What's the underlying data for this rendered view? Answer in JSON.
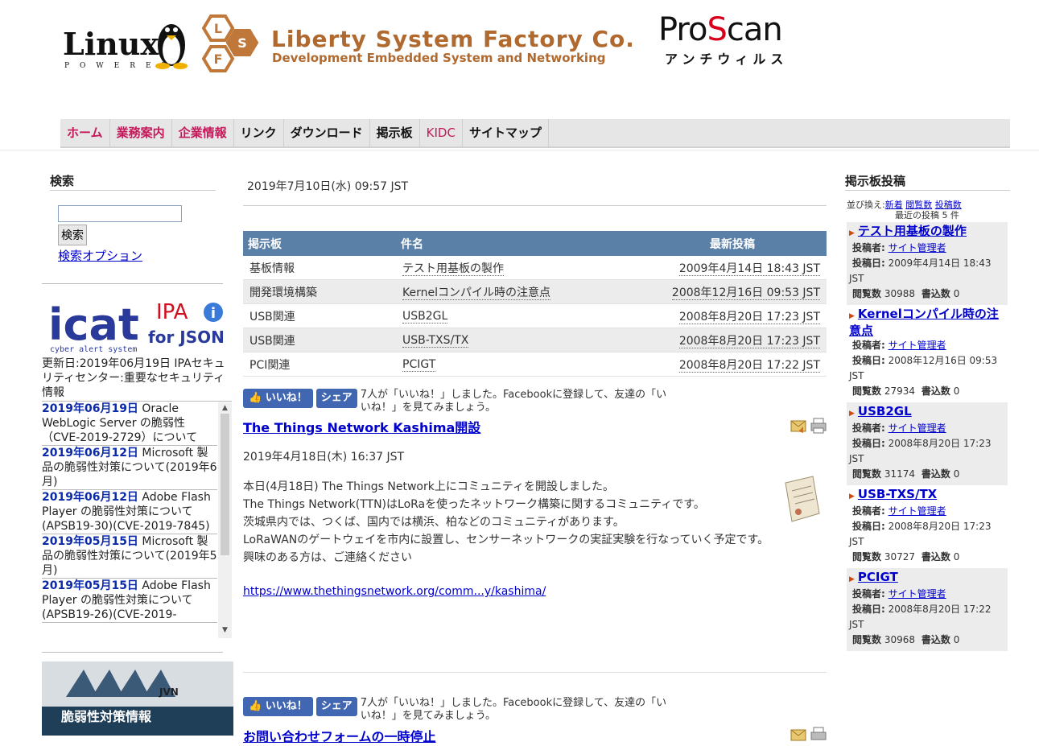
{
  "header": {
    "linux_logo_text": "Linux",
    "linux_logo_sub": "POWERED",
    "lsf_logo_letters": [
      "L",
      "S",
      "F"
    ],
    "company_name": "Liberty System Factory Co.",
    "company_tagline": "Development Embedded System and Networking",
    "proscan_pre": "Pro",
    "proscan_s": "S",
    "proscan_post": "can",
    "proscan_sub": "アンチウィルス",
    "brand_color": "#b06a2f"
  },
  "nav": [
    {
      "label": "ホーム",
      "style": "red"
    },
    {
      "label": "業務案内",
      "style": "red"
    },
    {
      "label": "企業情報",
      "style": "red"
    },
    {
      "label": "リンク",
      "style": "black"
    },
    {
      "label": "ダウンロード",
      "style": "black"
    },
    {
      "label": "掲示板",
      "style": "black"
    },
    {
      "label": "KIDC",
      "style": "kidc"
    },
    {
      "label": "サイトマップ",
      "style": "black"
    }
  ],
  "left": {
    "search_title": "検索",
    "search_button": "検索",
    "search_option": "検索オプション",
    "icat_brand": "icat",
    "icat_sub": "cyber alert system",
    "icat_ipa": "IPA",
    "icat_json": "for JSON",
    "icat_updated": "更新日:2019年06月19日 IPAセキュリティセンター:重要なセキュリティ情報",
    "icat_items": [
      {
        "date": "2019年06月19日",
        "text": "Oracle WebLogic Server の脆弱性（CVE-2019-2729）について"
      },
      {
        "date": "2019年06月12日",
        "text": "Microsoft 製品の脆弱性対策について(2019年6月)"
      },
      {
        "date": "2019年06月12日",
        "text": "Adobe Flash Player の脆弱性対策について(APSB19-30)(CVE-2019-7845)"
      },
      {
        "date": "2019年05月15日",
        "text": "Microsoft 製品の脆弱性対策について(2019年5月)"
      },
      {
        "date": "2019年05月15日",
        "text": "Adobe Flash Player の脆弱性対策について(APSB19-26)(CVE-2019-"
      }
    ],
    "jvn_label": "JVN",
    "jvn_caption": "脆弱性対策情報"
  },
  "main": {
    "date1": "2019年7月10日(水) 09:57 JST",
    "table": {
      "headers": [
        "掲示板",
        "件名",
        "最新投稿"
      ],
      "rows": [
        {
          "board": "基板情報",
          "subject": "テスト用基板の製作",
          "latest": "2009年4月14日 18:43 JST"
        },
        {
          "board": "開発環境構築",
          "subject": "Kernelコンパイル時の注意点",
          "latest": "2008年12月16日 09:53 JST"
        },
        {
          "board": "USB関連",
          "subject": "USB2GL",
          "latest": "2008年8月20日 17:23 JST"
        },
        {
          "board": "USB関連",
          "subject": "USB-TXS/TX",
          "latest": "2008年8月20日 17:23 JST"
        },
        {
          "board": "PCI関連",
          "subject": "PCIGT",
          "latest": "2008年8月20日 17:22 JST"
        }
      ]
    },
    "fb": {
      "like": "いいね！",
      "share": "シェア",
      "text_pre": "7人が「いいね！」しました。Facebookに",
      "text_link": "登録",
      "text_post": "して、友達の「いいね！」を見てみましょう。"
    },
    "article_title": "The Things Network Kashima開設",
    "article_date": "2019年4月18日(木) 16:37 JST",
    "article_lines": [
      "本日(4月18日) The Things Network上にコミュニティを開設しました。",
      "The Things Network(TTN)はLoRaを使ったネットワーク構築に関するコミュニティです。",
      "茨城県内では、つくば、国内では横浜、柏などのコミュニティがあります。",
      "LoRaWANのゲートウェイを市内に設置し、センサーネットワークの実証実験を行なっていく予定です。",
      "興味のある方は、ご連絡ください"
    ],
    "article_link": "https://www.thethingsnetwork.org/comm...y/kashima/",
    "article2_title": "お問い合わせフォームの一時停止"
  },
  "right": {
    "title": "掲示板投稿",
    "sort_label": "並び換え:",
    "sort_new": "新着",
    "sort_views": "閲覧数",
    "sort_posts": "投稿数",
    "recent": "最近の投稿 5 件",
    "labels": {
      "poster": "投稿者:",
      "date": "投稿日:",
      "views": "閲覧数",
      "replies": "書込数"
    },
    "posts": [
      {
        "title": "テスト用基板の製作",
        "poster": "サイト管理者",
        "date": "2009年4月14日 18:43 JST",
        "views": "30988",
        "replies": "0"
      },
      {
        "title": "Kernelコンパイル時の注意点",
        "poster": "サイト管理者",
        "date": "2008年12月16日 09:53 JST",
        "views": "27934",
        "replies": "0"
      },
      {
        "title": "USB2GL",
        "poster": "サイト管理者",
        "date": "2008年8月20日 17:23 JST",
        "views": "31174",
        "replies": "0"
      },
      {
        "title": "USB-TXS/TX",
        "poster": "サイト管理者",
        "date": "2008年8月20日 17:23 JST",
        "views": "30727",
        "replies": "0"
      },
      {
        "title": "PCIGT",
        "poster": "サイト管理者",
        "date": "2008年8月20日 17:22 JST",
        "views": "30968",
        "replies": "0"
      }
    ]
  }
}
